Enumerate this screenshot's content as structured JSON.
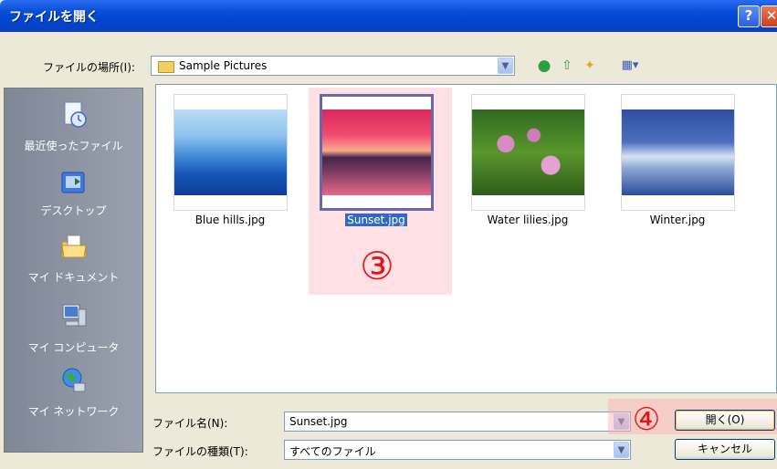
{
  "window": {
    "title": "ファイルを開く",
    "help_glyph": "?",
    "close_glyph": "✕"
  },
  "toolbar": {
    "location_label": "ファイルの場所(I):",
    "location_value": "Sample Pictures",
    "icons": [
      "back-icon",
      "up-folder-icon",
      "new-folder-icon",
      "views-menu-icon"
    ]
  },
  "places": [
    {
      "label": "最近使ったファイル",
      "icon": "recent-documents-icon"
    },
    {
      "label": "デスクトップ",
      "icon": "desktop-icon"
    },
    {
      "label": "マイ ドキュメント",
      "icon": "my-documents-icon"
    },
    {
      "label": "マイ コンピュータ",
      "icon": "my-computer-icon"
    },
    {
      "label": "マイ ネットワーク",
      "icon": "my-network-icon"
    }
  ],
  "files": [
    {
      "name": "Blue hills.jpg",
      "selected": false
    },
    {
      "name": "Sunset.jpg",
      "selected": true
    },
    {
      "name": "Water lilies.jpg",
      "selected": false
    },
    {
      "name": "Winter.jpg",
      "selected": false
    }
  ],
  "annotations": {
    "step3": "③",
    "step4": "④"
  },
  "form": {
    "filename_label": "ファイル名(N):",
    "filename_value": "Sunset.jpg",
    "filetype_label": "ファイルの種類(T):",
    "filetype_value": "すべてのファイル"
  },
  "buttons": {
    "open": "開く(O)",
    "cancel": "キャンセル"
  },
  "colors": {
    "annotation": "#e0161b",
    "selection": "#316ac5",
    "titlebar": "#0046d5"
  }
}
